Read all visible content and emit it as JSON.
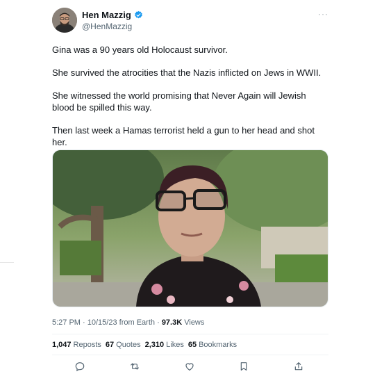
{
  "author": {
    "name": "Hen Mazzig",
    "handle": "@HenMazzig"
  },
  "more_icon": "more-horizontal-icon",
  "body": [
    "Gina was a 90 years old Holocaust survivor.",
    "She survived the atrocities that the Nazis inflicted on Jews in WWII.",
    "She witnessed the world promising that Never Again will Jewish blood be spilled this way.",
    "Then last week a Hamas terrorist held a gun to her head and shot her."
  ],
  "meta": {
    "time": "5:27 PM",
    "date": "10/15/23",
    "source": "from Earth",
    "views": "97.3K",
    "views_label": "Views"
  },
  "stats": {
    "reposts": "1,047",
    "reposts_label": "Reposts",
    "quotes": "67",
    "quotes_label": "Quotes",
    "likes": "2,310",
    "likes_label": "Likes",
    "bookmarks": "65",
    "bookmarks_label": "Bookmarks"
  },
  "actions": [
    "reply-icon",
    "repost-icon",
    "like-icon",
    "bookmark-icon",
    "share-icon"
  ],
  "colors": {
    "verified": "#1d9bf0",
    "text": "#0f1419",
    "secondary": "#536471"
  }
}
